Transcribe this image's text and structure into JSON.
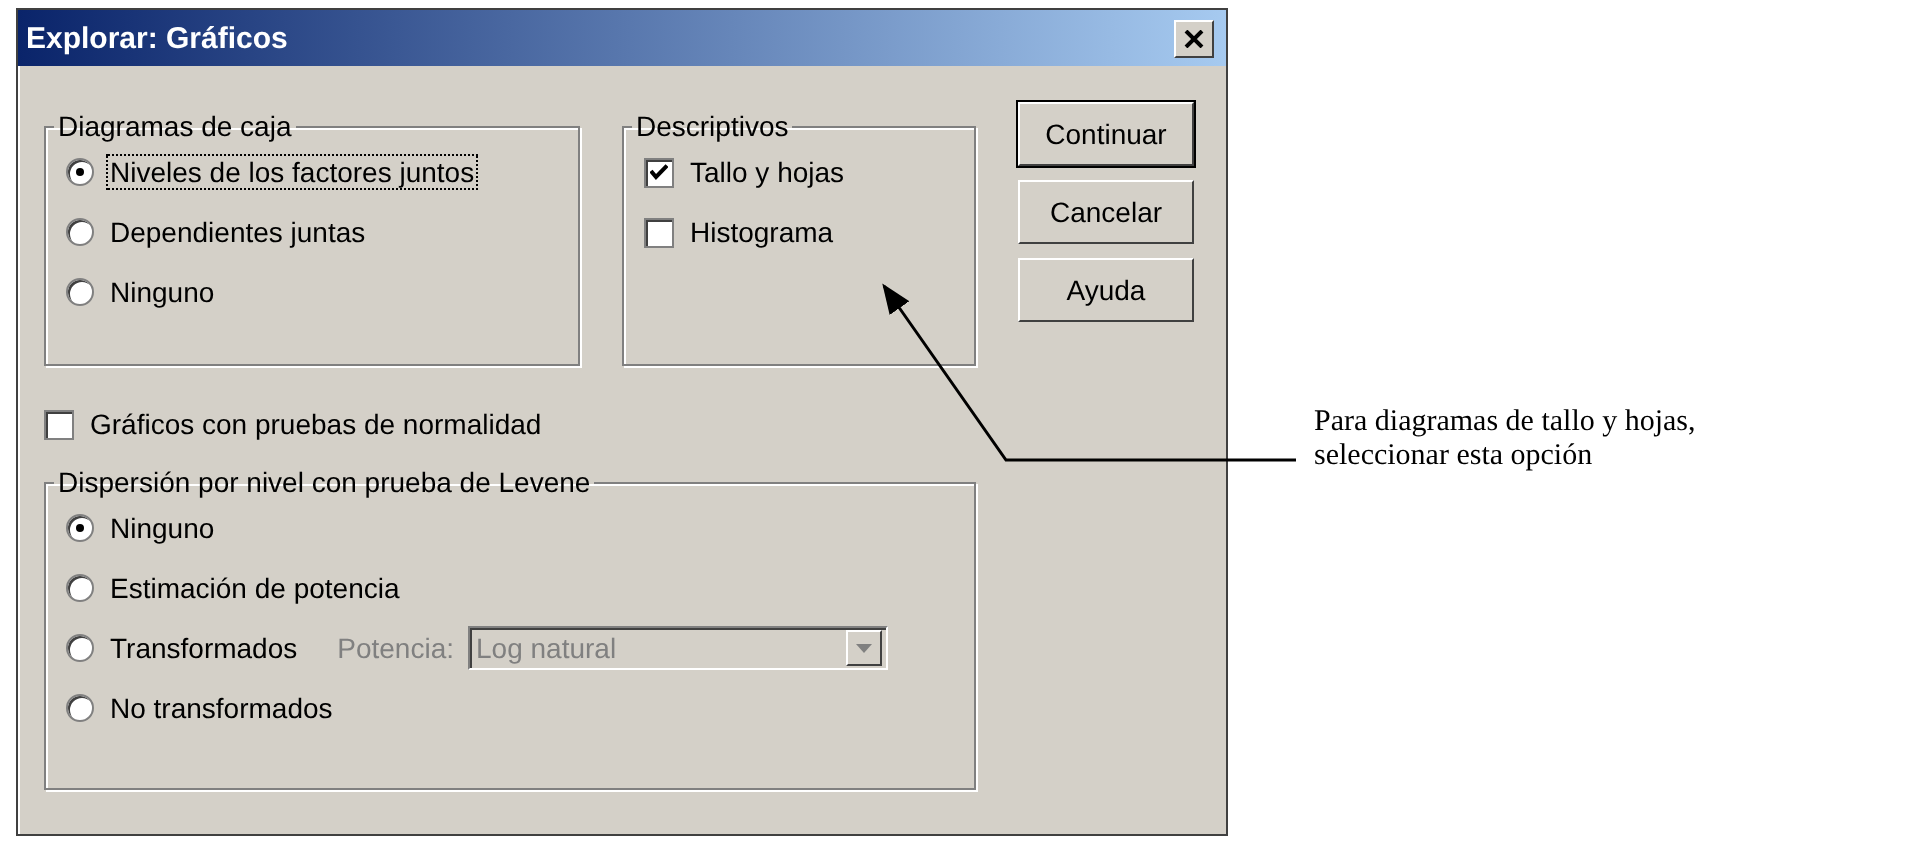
{
  "window": {
    "title": "Explorar: Gráficos"
  },
  "boxplots": {
    "title": "Diagramas de caja",
    "options": [
      {
        "label": "Niveles de los factores juntos",
        "selected": true,
        "focused": true
      },
      {
        "label": "Dependientes juntas",
        "selected": false,
        "focused": false
      },
      {
        "label": "Ninguno",
        "selected": false,
        "focused": false
      }
    ]
  },
  "descriptives": {
    "title": "Descriptivos",
    "options": [
      {
        "label": "Tallo y hojas",
        "checked": true
      },
      {
        "label": "Histograma",
        "checked": false
      }
    ]
  },
  "buttons": [
    {
      "label": "Continuar",
      "default": true
    },
    {
      "label": "Cancelar",
      "default": false
    },
    {
      "label": "Ayuda",
      "default": false
    }
  ],
  "normality": {
    "label": "Gráficos con pruebas de normalidad",
    "checked": false
  },
  "levene": {
    "title": "Dispersión por nivel con prueba de Levene",
    "options": [
      {
        "label": "Ninguno",
        "selected": true,
        "kind": "plain"
      },
      {
        "label": "Estimación de potencia",
        "selected": false,
        "kind": "plain"
      },
      {
        "label": "Transformados",
        "selected": false,
        "kind": "power"
      },
      {
        "label": "No transformados",
        "selected": false,
        "kind": "plain"
      }
    ],
    "power": {
      "label": "Potencia:",
      "value": "Log natural",
      "disabled": true
    }
  },
  "annotation": {
    "lines": [
      "Para diagramas de tallo y hojas,",
      "seleccionar  esta opción"
    ]
  }
}
